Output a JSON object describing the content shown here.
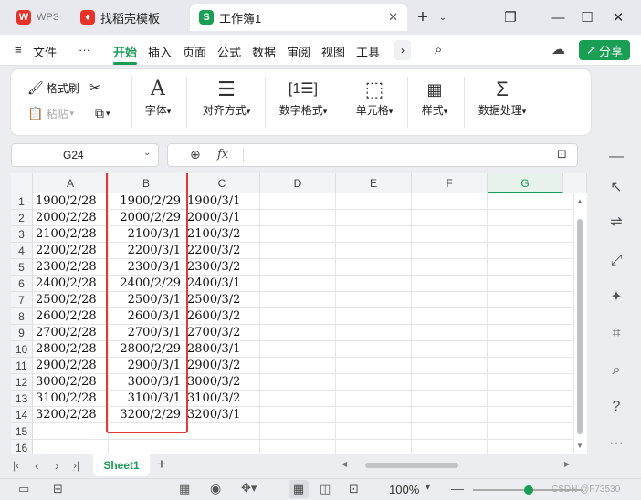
{
  "tabs": [
    {
      "label": "WPS",
      "icon_color": "#e6332a",
      "active": false
    },
    {
      "label": "找稻壳模板",
      "icon_color": "#e6332a",
      "active": false
    },
    {
      "label": "工作簿1",
      "icon_color": "#1a9e54",
      "icon_letter": "S",
      "active": true
    }
  ],
  "menu": {
    "file": "文件",
    "more": "···",
    "items": [
      "开始",
      "插入",
      "页面",
      "公式",
      "数据",
      "审阅",
      "视图",
      "工具"
    ],
    "share": "分享"
  },
  "ribbon": {
    "format_painter": "格式刷",
    "paste": "粘贴",
    "font": "字体",
    "align": "对齐方式",
    "number_format": "数字格式",
    "cells": "单元格",
    "style": "样式",
    "data_proc": "数据处理"
  },
  "formula": {
    "cell_ref": "G24",
    "fx": "fx",
    "content": ""
  },
  "columns": [
    "A",
    "B",
    "C",
    "D",
    "E",
    "F",
    "G"
  ],
  "rows": [
    {
      "n": "1",
      "a": "1900/2/28",
      "b": "1900/2/29",
      "c": "1900/3/1"
    },
    {
      "n": "2",
      "a": "2000/2/28",
      "b": "2000/2/29",
      "c": "2000/3/1"
    },
    {
      "n": "3",
      "a": "2100/2/28",
      "b": "2100/3/1",
      "c": "2100/3/2"
    },
    {
      "n": "4",
      "a": "2200/2/28",
      "b": "2200/3/1",
      "c": "2200/3/2"
    },
    {
      "n": "5",
      "a": "2300/2/28",
      "b": "2300/3/1",
      "c": "2300/3/2"
    },
    {
      "n": "6",
      "a": "2400/2/28",
      "b": "2400/2/29",
      "c": "2400/3/1"
    },
    {
      "n": "7",
      "a": "2500/2/28",
      "b": "2500/3/1",
      "c": "2500/3/2"
    },
    {
      "n": "8",
      "a": "2600/2/28",
      "b": "2600/3/1",
      "c": "2600/3/2"
    },
    {
      "n": "9",
      "a": "2700/2/28",
      "b": "2700/3/1",
      "c": "2700/3/2"
    },
    {
      "n": "10",
      "a": "2800/2/28",
      "b": "2800/2/29",
      "c": "2800/3/1"
    },
    {
      "n": "11",
      "a": "2900/2/28",
      "b": "2900/3/1",
      "c": "2900/3/2"
    },
    {
      "n": "12",
      "a": "3000/2/28",
      "b": "3000/3/1",
      "c": "3000/3/2"
    },
    {
      "n": "13",
      "a": "3100/2/28",
      "b": "3100/3/1",
      "c": "3100/3/2"
    },
    {
      "n": "14",
      "a": "3200/2/28",
      "b": "3200/2/29",
      "c": "3200/3/1"
    },
    {
      "n": "15",
      "a": "",
      "b": "",
      "c": ""
    },
    {
      "n": "16",
      "a": "",
      "b": "",
      "c": ""
    }
  ],
  "sheet_tab": "Sheet1",
  "status": {
    "zoom": "100%",
    "watermark": "CSDN @F73530"
  },
  "colors": {
    "accent": "#1a9e54",
    "highlight_box": "#e53935"
  }
}
